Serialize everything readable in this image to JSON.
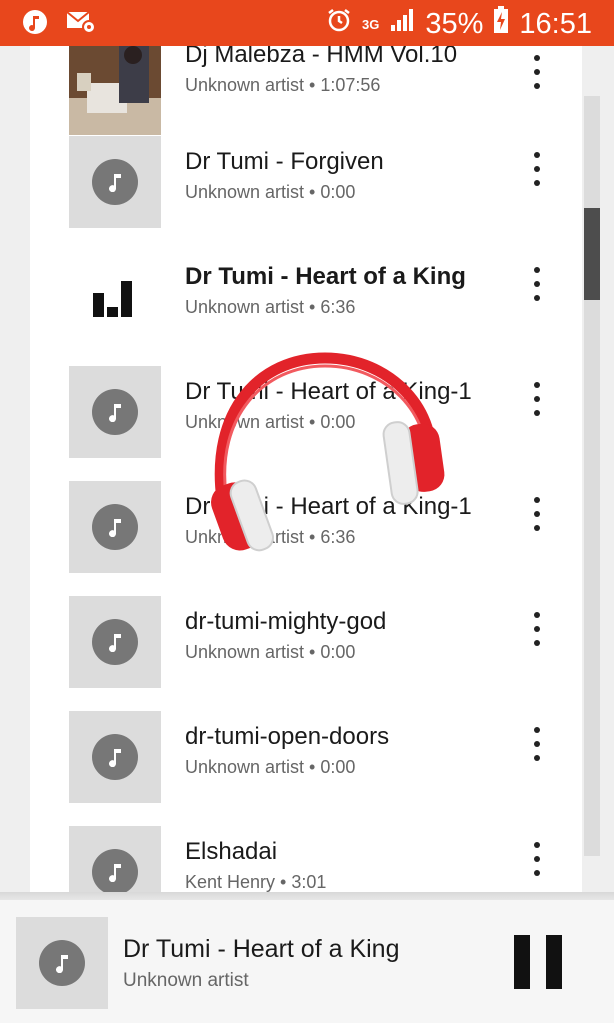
{
  "status_bar": {
    "battery": "35%",
    "time": "16:51",
    "network": "3G",
    "icons": [
      "music-app-icon",
      "email-settings-icon",
      "alarm-icon",
      "network-3g-icon",
      "signal-icon",
      "battery-charging-icon"
    ]
  },
  "colors": {
    "status_bar": "#e8471c",
    "headphones": "#e2232a"
  },
  "tracks": [
    {
      "title": "Dj Malebza - HMM Vol.10",
      "subtitle": "Unknown artist • 1:07:56",
      "art": "photo"
    },
    {
      "title": "Dr Tumi - Forgiven",
      "subtitle": "Unknown artist • 0:00",
      "art": "music-note-icon"
    },
    {
      "title": "Dr Tumi - Heart of a King",
      "subtitle": "Unknown artist • 6:36",
      "art": "now-playing-bars-icon",
      "playing": true
    },
    {
      "title": "Dr Tumi - Heart of a King-1",
      "subtitle": "Unknown artist • 0:00",
      "art": "music-note-icon"
    },
    {
      "title": "Dr Tumi - Heart of a King-1",
      "subtitle": "Unknown artist • 6:36",
      "art": "music-note-icon"
    },
    {
      "title": "dr-tumi-mighty-god",
      "subtitle": "Unknown artist • 0:00",
      "art": "music-note-icon"
    },
    {
      "title": "dr-tumi-open-doors",
      "subtitle": "Unknown artist • 0:00",
      "art": "music-note-icon"
    },
    {
      "title": "Elshadai",
      "subtitle": "Kent Henry • 3:01",
      "art": "music-note-icon"
    }
  ],
  "now_playing": {
    "title": "Dr Tumi - Heart of a King",
    "subtitle": "Unknown artist",
    "control": "pause-icon"
  },
  "overlay": {
    "icon": "headphones-icon"
  }
}
